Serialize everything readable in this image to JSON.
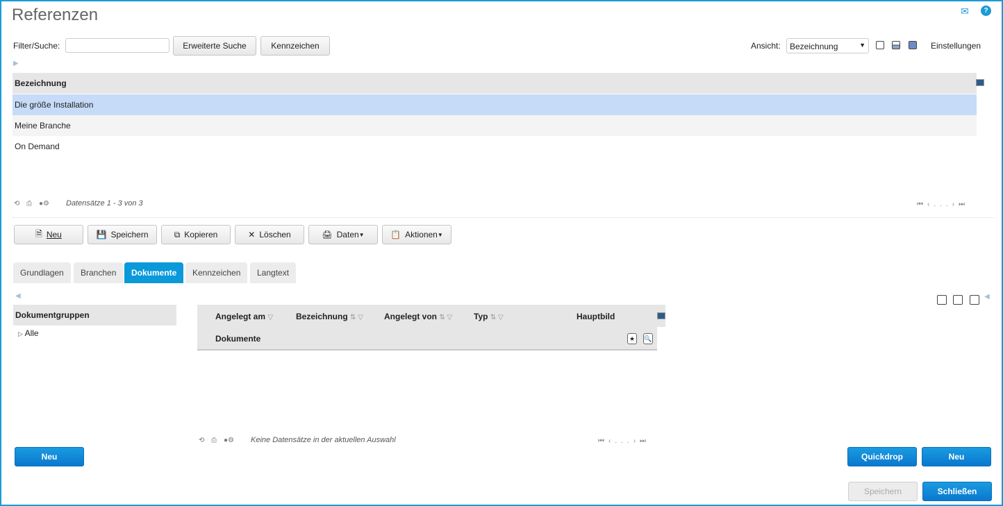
{
  "title": "Referenzen",
  "filter": {
    "label": "Filter/Suche:",
    "value": "",
    "extended_search": "Erweiterte Suche",
    "kennzeichen": "Kennzeichen"
  },
  "view": {
    "label": "Ansicht:",
    "selected": "Bezeichnung",
    "settings": "Einstellungen"
  },
  "list": {
    "header": "Bezeichnung",
    "rows": [
      "Die größe Installation",
      "Meine Branche",
      "On Demand"
    ],
    "status": "Datensätze 1 - 3 von 3",
    "pager_dots": "..."
  },
  "toolbar": {
    "neu": "Neu",
    "speichern": "Speichern",
    "kopieren": "Kopieren",
    "loeschen": "Löschen",
    "daten": "Daten",
    "aktionen": "Aktionen"
  },
  "tabs": [
    "Grundlagen",
    "Branchen",
    "Dokumente",
    "Kennzeichen",
    "Langtext"
  ],
  "active_tab": "Dokumente",
  "docgroups": {
    "header": "Dokumentgruppen",
    "items": [
      "Alle"
    ],
    "new": "Neu"
  },
  "documents": {
    "columns": [
      "Angelegt am",
      "Bezeichnung",
      "Angelegt von",
      "Typ",
      "Hauptbild"
    ],
    "group_label": "Dokumente",
    "status": "Keine Datensätze in der aktuellen Auswahl",
    "pager_dots": "..."
  },
  "footer": {
    "quickdrop": "Quickdrop",
    "neu": "Neu",
    "speichern": "Speichern",
    "schliessen": "Schließen"
  },
  "colors": {
    "accent": "#0a99d9",
    "selected_row": "#c6dbf7"
  }
}
